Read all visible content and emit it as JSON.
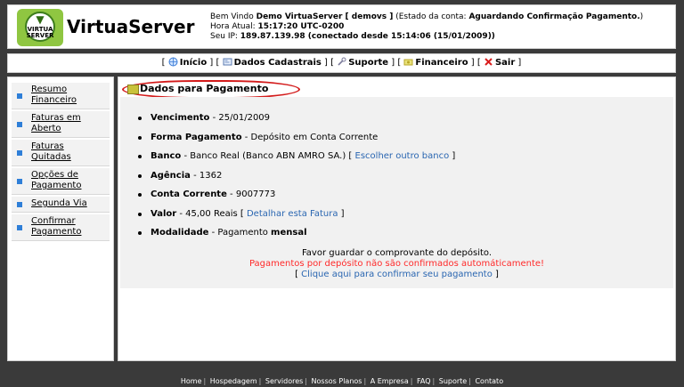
{
  "header": {
    "logo_text": "VIRTUA SERVER",
    "brand": "VirtuaServer",
    "welcome_line_prefix": "Bem Vindo ",
    "welcome_user": "Demo VirtuaServer [ demovs ]",
    "welcome_status_prefix": " (Estado da conta: ",
    "welcome_status": "Aguardando Confirmação Pagamento.",
    "welcome_status_suffix": ")",
    "time_label": "Hora Atual: ",
    "time_value": "15:17:20 UTC-0200",
    "ip_label": "Seu IP: ",
    "ip_value": "189.87.139.98 (conectado desde 15:14:06 (15/01/2009))"
  },
  "nav": {
    "items": [
      {
        "label": "Início",
        "icon": "globe-icon",
        "color": "#3a7bd5"
      },
      {
        "label": "Dados Cadastrais",
        "icon": "address-card-icon",
        "color": "#5a7ab0"
      },
      {
        "label": "Suporte",
        "icon": "wrench-icon",
        "color": "#7a7a9a"
      },
      {
        "label": "Financeiro",
        "icon": "money-icon",
        "color": "#b8a626"
      },
      {
        "label": "Sair",
        "icon": "close-icon",
        "color": "#d91c1c"
      }
    ]
  },
  "sidebar": {
    "items": [
      {
        "label": "Resumo Financeiro"
      },
      {
        "label": "Faturas em Aberto"
      },
      {
        "label": "Faturas Quitadas"
      },
      {
        "label": "Opções de Pagamento"
      },
      {
        "label": "Segunda Via"
      },
      {
        "label": "Confirmar Pagamento"
      }
    ]
  },
  "main": {
    "title": "Dados para Pagamento",
    "details": {
      "vencimento_label": "Vencimento",
      "vencimento_value": " - 25/01/2009",
      "forma_label": "Forma Pagamento",
      "forma_value": " - Depósito em Conta Corrente",
      "banco_label": "Banco",
      "banco_value": " - Banco Real (Banco ABN AMRO SA.) [ ",
      "banco_link": "Escolher outro banco",
      "banco_suffix": " ]",
      "agencia_label": "Agência",
      "agencia_value": " - 1362",
      "conta_label": "Conta Corrente",
      "conta_value": " - 9007773",
      "valor_label": "Valor",
      "valor_value": " - 45,00 Reais [ ",
      "valor_link": "Detalhar esta Fatura",
      "valor_suffix": " ]",
      "modalidade_label": "Modalidade",
      "modalidade_value": " - Pagamento ",
      "modalidade_bold": "mensal"
    },
    "notes": {
      "note1": "Favor guardar o comprovante do depósito.",
      "warning": "Pagamentos por depósito não são confirmados automáticamente!",
      "confirm_prefix": "[ ",
      "confirm_link": "Clique aqui para confirmar seu pagamento",
      "confirm_suffix": " ]"
    }
  },
  "footer": {
    "links": [
      "Home",
      "Hospedagem",
      "Servidores",
      "Nossos Planos",
      "A Empresa",
      "FAQ",
      "Suporte",
      "Contato"
    ]
  }
}
